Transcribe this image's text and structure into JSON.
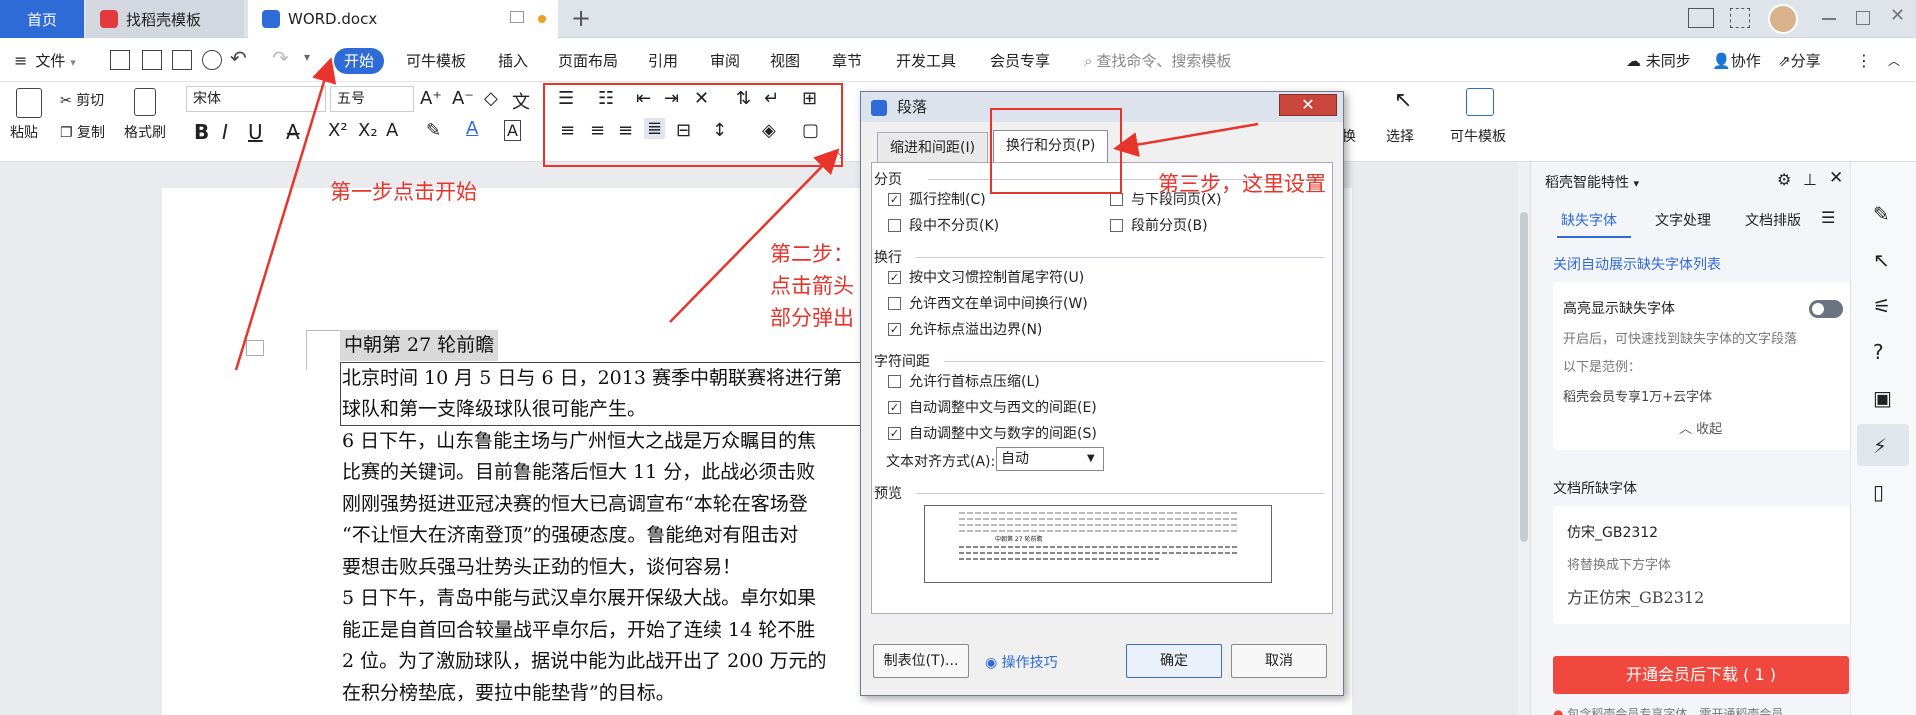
{
  "tabs": {
    "home": "首页",
    "daoke": "找稻壳模板",
    "doc": "WORD.docx"
  },
  "menubar": {
    "file": "文件",
    "start": "开始",
    "keniu": "可牛模板",
    "insert": "插入",
    "layout": "页面布局",
    "ref": "引用",
    "review": "审阅",
    "view": "视图",
    "section": "章节",
    "dev": "开发工具",
    "vip": "会员专享",
    "search_placeholder": "查找命令、搜索模板",
    "unsync": "未同步",
    "collab": "协作",
    "share": "分享"
  },
  "ribbon": {
    "paste": "粘贴",
    "cut": "剪切",
    "copy": "复制",
    "format_painter": "格式刷",
    "font": "宋体",
    "size": "五号",
    "replace": "换",
    "select": "选择",
    "keniu": "可牛模板"
  },
  "document": {
    "title": "中朝第 27 轮前瞻",
    "lines": [
      "北京时间 10 月 5 日与 6 日，2013 赛季中朝联赛将进行第",
      "球队和第一支降级球队很可能产生。",
      "6 日下午，山东鲁能主场与广州恒大之战是万众瞩目的焦",
      "比赛的关键词。目前鲁能落后恒大 11 分，此战必须击败",
      "刚刚强势挺进亚冠决赛的恒大已高调宣布“本轮在客场登",
      "“不让恒大在济南登顶”的强硬态度。鲁能绝对有阻击对",
      "要想击败兵强马壮势头正劲的恒大，谈何容易！",
      "5 日下午，青岛中能与武汉卓尔展开保级大战。卓尔如果",
      "能正是自首回合较量战平卓尔后，开始了连续 14 轮不胜",
      "2 位。为了激励球队，据说中能为此战开出了 200 万元的",
      "在积分榜垫底，要拉中能垫背”的目标。"
    ]
  },
  "dialog": {
    "title": "段落",
    "tab1": "缩进和间距(I)",
    "tab2": "换行和分页(P)",
    "group1": "分页",
    "widow": "孤行控制(C)",
    "keep_next": "与下段同页(X)",
    "keep_lines": "段中不分页(K)",
    "page_before": "段前分页(B)",
    "group2": "换行",
    "cjk_rule": "按中文习惯控制首尾字符(U)",
    "wrap_latin": "允许西文在单词中间换行(W)",
    "hang_punct": "允许标点溢出边界(N)",
    "group3": "字符间距",
    "compress": "允许行首标点压缩(L)",
    "auto_latin": "自动调整中文与西文的间距(E)",
    "auto_num": "自动调整中文与数字的间距(S)",
    "align_label": "文本对齐方式(A):",
    "align_value": "自动",
    "preview_label": "预览",
    "preview_sample": "中朝第 27 轮前瞻",
    "tabs_btn": "制表位(T)...",
    "tips": "操作技巧",
    "ok": "确定",
    "cancel": "取消",
    "close": "✕"
  },
  "rpanel": {
    "title": "稻壳智能特性",
    "tab_missing": "缺失字体",
    "tab_text": "文字处理",
    "tab_layout": "文档排版",
    "close_auto": "关闭自动展示缺失字体列表",
    "highlight_title": "高亮显示缺失字体",
    "highlight_desc": "开启后，可快速找到缺失字体的文字段落",
    "example_label": "以下是范例：",
    "example_font": "稻壳会员专享1万+云字体",
    "collapse": "收起",
    "doc_missing": "文档所缺字体",
    "font_missing": "仿宋_GB2312",
    "replace_hint": "将替换成下方字体",
    "font_replace": "方正仿宋_GB2312",
    "download": "开通会员后下载 ( 1 )",
    "footer": "包含稻壳会员专享字体，需开通稻壳会员"
  },
  "annotations": {
    "step1": "第一步点击开始",
    "step2a": "第二步：",
    "step2b": "点击箭头",
    "step2c": "部分弹出",
    "step3": "第三步，这里设置"
  },
  "colors": {
    "accent": "#2f6bd7",
    "annotation": "#e8342b",
    "download": "#f0483e"
  }
}
